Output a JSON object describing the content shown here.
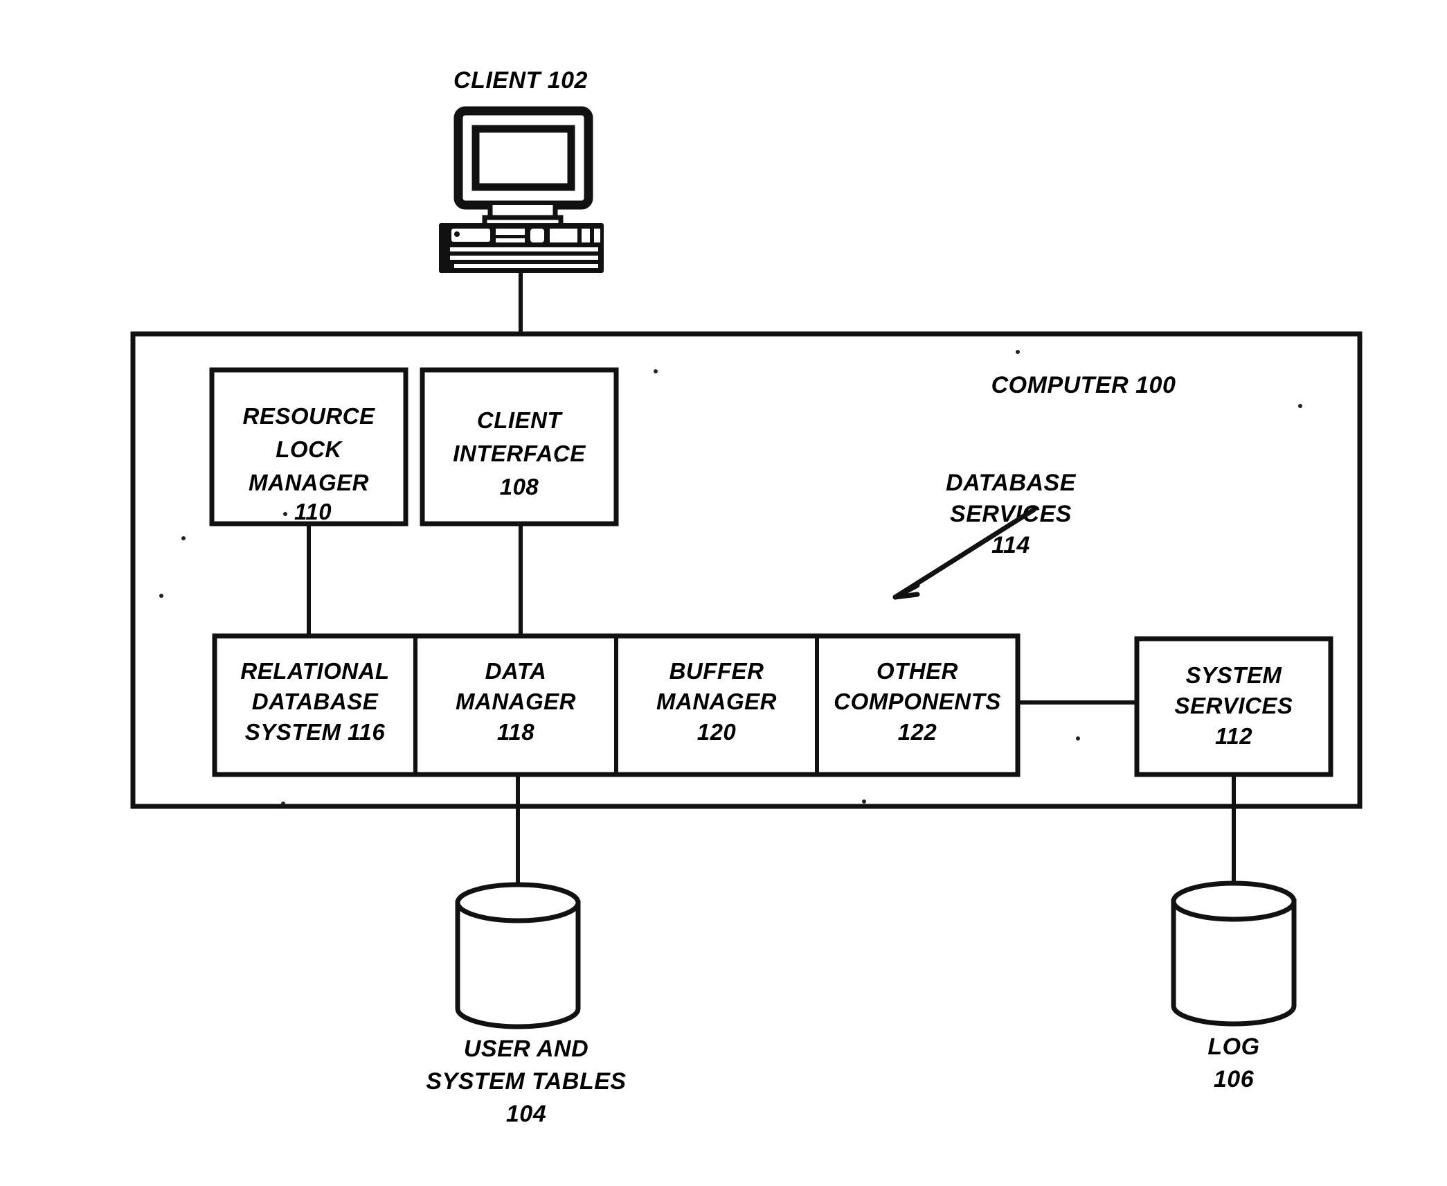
{
  "figure": {
    "type": "patent-block-diagram",
    "title": "Database system architecture block diagram"
  },
  "client": {
    "label": "CLIENT 102",
    "icon": "desktop-computer-icon"
  },
  "computer": {
    "label": "COMPUTER 100"
  },
  "database_services": {
    "line1": "DATABASE",
    "line2": "SERVICES",
    "line3": "114",
    "arrow": "arrow-pointing-down-left"
  },
  "top_boxes": [
    {
      "id": "resource-lock-manager",
      "lines": [
        "RESOURCE",
        "LOCK",
        "MANAGER",
        "110"
      ]
    },
    {
      "id": "client-interface",
      "lines": [
        "CLIENT",
        "INTERFACE",
        "108"
      ]
    }
  ],
  "service_boxes": [
    {
      "id": "relational-database-system",
      "lines": [
        "RELATIONAL",
        "DATABASE",
        "SYSTEM 116"
      ]
    },
    {
      "id": "data-manager",
      "lines": [
        "DATA",
        "MANAGER",
        "118"
      ]
    },
    {
      "id": "buffer-manager",
      "lines": [
        "BUFFER",
        "MANAGER",
        "120"
      ]
    },
    {
      "id": "other-components",
      "lines": [
        "OTHER",
        "COMPONENTS",
        "122"
      ]
    }
  ],
  "system_services": {
    "id": "system-services",
    "lines": [
      "SYSTEM",
      "SERVICES",
      "112"
    ]
  },
  "storage": [
    {
      "id": "user-and-system-tables",
      "icon": "database-cylinder-icon",
      "lines": [
        "USER AND",
        "SYSTEM TABLES",
        "104"
      ]
    },
    {
      "id": "log",
      "icon": "database-cylinder-icon",
      "lines": [
        "LOG",
        "106"
      ]
    }
  ],
  "colors": {
    "ink": "#111111",
    "paper": "#ffffff"
  }
}
